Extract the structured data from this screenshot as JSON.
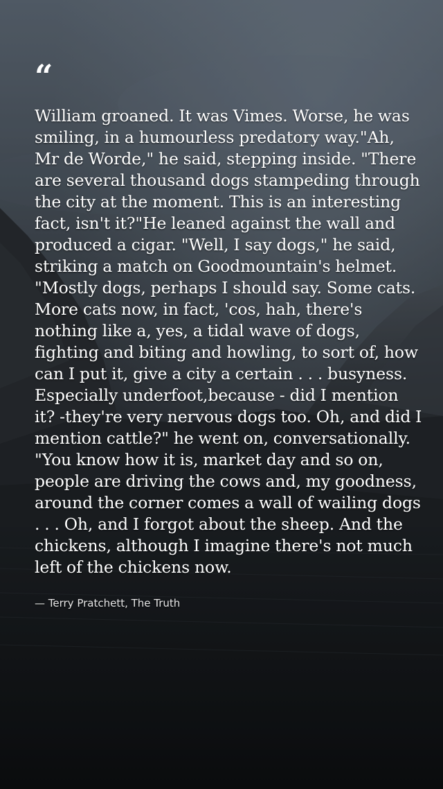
{
  "quote": {
    "mark": "“",
    "text": "William groaned. It was Vimes. Worse, he was smiling, in a humourless predatory way.\"Ah, Mr de Worde,\" he said, stepping inside. \"There are several thousand dogs stampeding through the city at the moment. This is an interesting fact, isn't it?\"He leaned against the wall and produced a cigar. \"Well, I say dogs,\" he said, striking a match on Goodmountain's helmet. \"Mostly dogs, perhaps I should say. Some cats. More cats now, in fact, 'cos, hah, there's nothing like a, yes, a tidal wave of dogs, fighting and biting and howling, to sort of, how can I put it, give a city a certain . . . busyness. Especially underfoot,because - did I mention it? -they're very nervous dogs too. Oh, and did I mention cattle?\" he went on, conversationally. \"You know how it is, market day and so on, people are driving the cows and, my goodness, around the corner comes a wall of wailing dogs . . . Oh, and I forgot about the sheep. And the chickens, although I imagine there's not much left of the chickens now.",
    "attribution": "— Terry Pratchett, The Truth"
  },
  "colors": {
    "text": "#ffffff",
    "sky_top": "#5e6a77",
    "ground": "#121417"
  }
}
